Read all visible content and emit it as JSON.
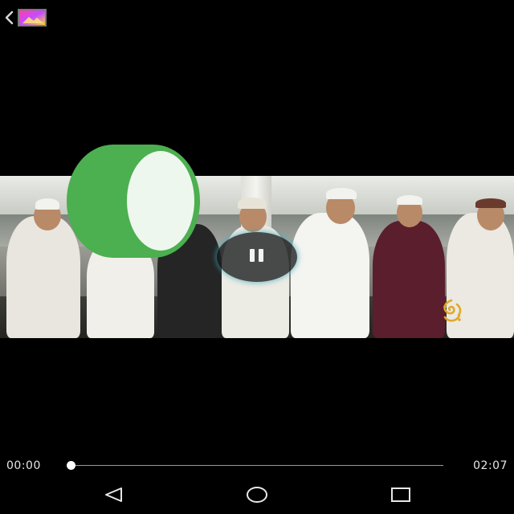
{
  "player": {
    "time_current": "00:00",
    "time_total": "02:07",
    "progress_fraction": 0.0
  },
  "topbar": {
    "back_icon": "chevron-left-icon",
    "thumbnail_icon": "gallery-thumbnail-icon"
  },
  "overlay": {
    "pause_icon": "pause-icon",
    "green_bubble": "green-toggle-bubble"
  },
  "navbar": {
    "back_icon": "triangle-back-icon",
    "home_icon": "circle-home-icon",
    "recents_icon": "square-recents-icon"
  },
  "colors": {
    "background": "#000000",
    "bubble_green": "#4caf50",
    "bubble_inner": "#eef7ee",
    "seek_track": "#9a9a9a",
    "text": "#e6e6e6"
  }
}
